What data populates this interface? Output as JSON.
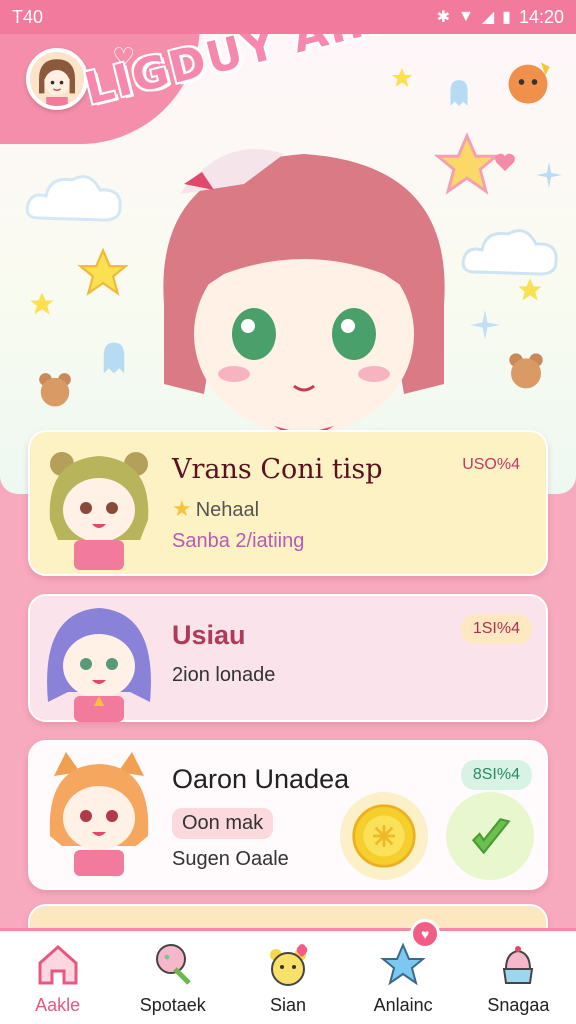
{
  "status_bar": {
    "time_left": "T40",
    "time_right": "14:20",
    "icons": [
      "bluetooth-icon",
      "wifi-icon",
      "signal-icon",
      "battery-icon"
    ]
  },
  "header": {
    "title": "LIGDUY AIRIUI"
  },
  "cards": [
    {
      "title": "Vrans Coni tisp",
      "badge": "USO%4",
      "line1": "Nehaal",
      "line2": "Sanba 2/iatiing",
      "bg": "#fdf2c4"
    },
    {
      "title": "Usiau",
      "badge": "1SI%4",
      "line1": "2ion lonade",
      "bg": "#fbe3ec"
    },
    {
      "title": "Oaron Unadea",
      "badge": "8SI%4",
      "pill": "Oon  mak",
      "line1": "Sugen Oaale",
      "bg": "#fffafc"
    }
  ],
  "nav": {
    "items": [
      {
        "label": "Aakle",
        "icon": "home-icon",
        "active": true
      },
      {
        "label": "Spotaek",
        "icon": "ice-cream-icon",
        "active": false
      },
      {
        "label": "Sian",
        "icon": "bear-icon",
        "active": false
      },
      {
        "label": "Anlainc",
        "icon": "star-icon",
        "active": false
      },
      {
        "label": "Snagaa",
        "icon": "cake-icon",
        "active": false
      }
    ]
  },
  "colors": {
    "accent": "#f27a9c",
    "nav_active": "#e8587e"
  }
}
